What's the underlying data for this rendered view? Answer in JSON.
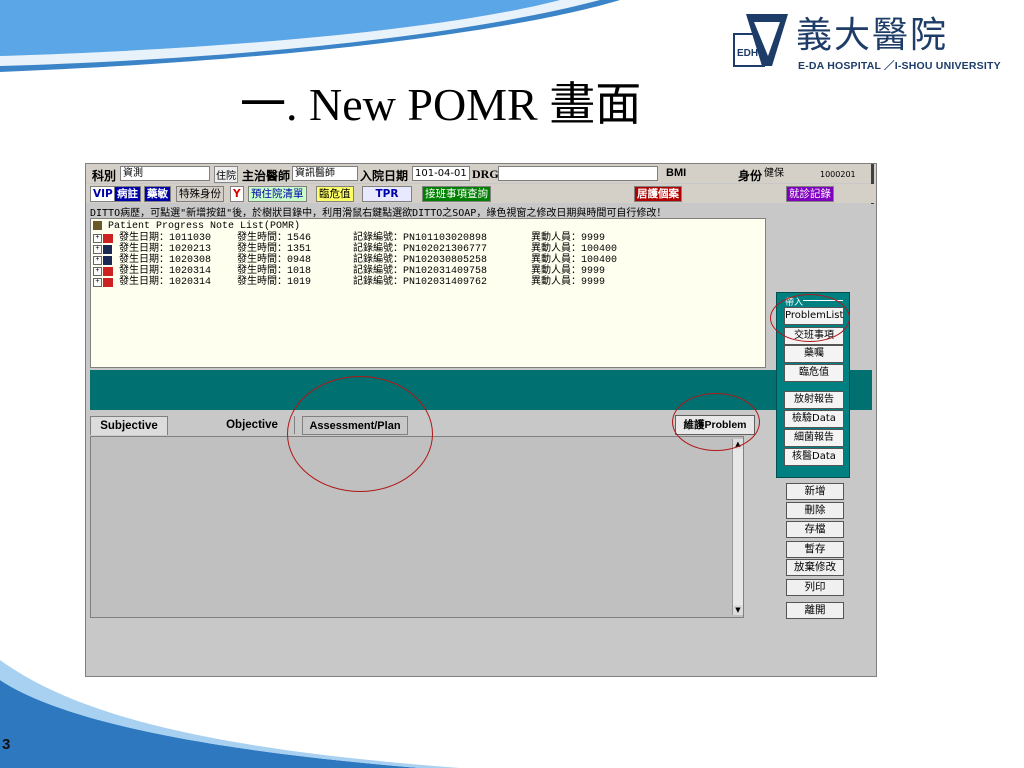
{
  "slide": {
    "title": "一. New POMR  畫面",
    "page_number": "3",
    "logo": {
      "chinese_name": "義大醫院",
      "english_name": "E-DA HOSPITAL ／I-SHOU UNIVERSITY",
      "mark_text": "EDH"
    }
  },
  "app": {
    "header_row1": {
      "dept_label": "科別",
      "dept_value": "資測",
      "inpatient_tag": "住院",
      "attending_label": "主治醫師",
      "attending_value": "資訊醫師",
      "admit_label": "入院日期",
      "admit_value": "101-04-01",
      "drg_label": "DRG",
      "drg_value": "",
      "bmi_label": "BMI",
      "identity_label": "身份",
      "identity_value": "健保",
      "record_no": "1000201"
    },
    "toolbar": {
      "vip": "VIP",
      "notes": "病註",
      "allergy": "藥敏",
      "special_identity": "特殊身份",
      "y_flag": "Y",
      "pre_discharge": "預住院清單",
      "critical": "臨危值",
      "tpr": "TPR",
      "handoff_query": "接班事項查詢",
      "home_care": "居護個案",
      "visit_record": "就診記錄"
    },
    "ditto_hint": "DITTO病歷，可點選\"新增按鈕\"後，於樹狀目錄中，利用滑鼠右鍵點選欲DITTO之SOAP，綠色視窗之修改日期與時間可自行修改！",
    "tree": {
      "root_label": "Patient Progress Note List(POMR)",
      "items": [
        {
          "icon": "book-icon",
          "date": "發生日期：1011030",
          "time": "發生時間：1546",
          "record": "記錄編號：PN101103020898",
          "editor": "異動人員：9999"
        },
        {
          "icon": "disk-icon",
          "date": "發生日期：1020213",
          "time": "發生時間：1351",
          "record": "記錄編號：PN102021306777",
          "editor": "異動人員：100400"
        },
        {
          "icon": "disk-icon",
          "date": "發生日期：1020308",
          "time": "發生時間：0948",
          "record": "記錄編號：PN102030805258",
          "editor": "異動人員：100400"
        },
        {
          "icon": "book-icon",
          "date": "發生日期：1020314",
          "time": "發生時間：1018",
          "record": "記錄編號：PN102031409758",
          "editor": "異動人員：9999"
        },
        {
          "icon": "book-icon",
          "date": "發生日期：1020314",
          "time": "發生時間：1019",
          "record": "記錄編號：PN102031409762",
          "editor": "異動人員：9999"
        }
      ]
    },
    "side_panel": {
      "caption": "帶入",
      "buttons": [
        "ProblemList",
        "交班事項",
        "藥囑",
        "臨危值",
        "放射報告",
        "檢驗Data",
        "細菌報告",
        "核醫Data"
      ]
    },
    "tabs": [
      "Subjective",
      "Objective",
      "Assessment/Plan"
    ],
    "problem_tab": "維護Problem",
    "actions": [
      "新增",
      "刪除",
      "存檔",
      "暫存",
      "放棄修改",
      "列印",
      "離開"
    ],
    "colors": {
      "teal": "#007070",
      "annotation": "#b01818"
    }
  }
}
